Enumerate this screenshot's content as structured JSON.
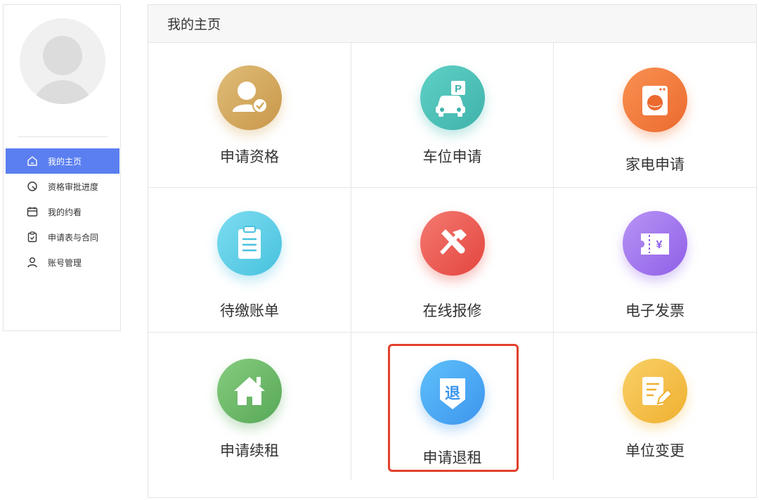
{
  "sidebar": {
    "menu": [
      {
        "label": "我的主页",
        "icon": "home-icon",
        "active": true
      },
      {
        "label": "资格审批进度",
        "icon": "progress-icon",
        "active": false
      },
      {
        "label": "我的约看",
        "icon": "calendar-icon",
        "active": false
      },
      {
        "label": "申请表与合同",
        "icon": "clipboard-icon",
        "active": false
      },
      {
        "label": "账号管理",
        "icon": "user-icon",
        "active": false
      }
    ]
  },
  "main": {
    "title": "我的主页",
    "tiles": [
      {
        "label": "申请资格",
        "icon": "user-check-icon",
        "color": "#d4a85c"
      },
      {
        "label": "车位申请",
        "icon": "parking-car-icon",
        "color": "#4cc1b8"
      },
      {
        "label": "家电申请",
        "icon": "washing-machine-icon",
        "color": "#f27a3d"
      },
      {
        "label": "待缴账单",
        "icon": "bill-clipboard-icon",
        "color": "#5ccfe6"
      },
      {
        "label": "在线报修",
        "icon": "repair-tools-icon",
        "color": "#ee5a52"
      },
      {
        "label": "电子发票",
        "icon": "invoice-ticket-icon",
        "color": "#a370f0"
      },
      {
        "label": "申请续租",
        "icon": "house-icon",
        "color": "#6cba6a"
      },
      {
        "label": "申请退租",
        "icon": "checkout-shield-icon",
        "color": "#4aa8f5",
        "badge": "退"
      },
      {
        "label": "单位变更",
        "icon": "edit-document-icon",
        "color": "#f5c248"
      }
    ]
  },
  "colors": {
    "accent": "#5b7ff0",
    "highlight": "#e2402c"
  }
}
